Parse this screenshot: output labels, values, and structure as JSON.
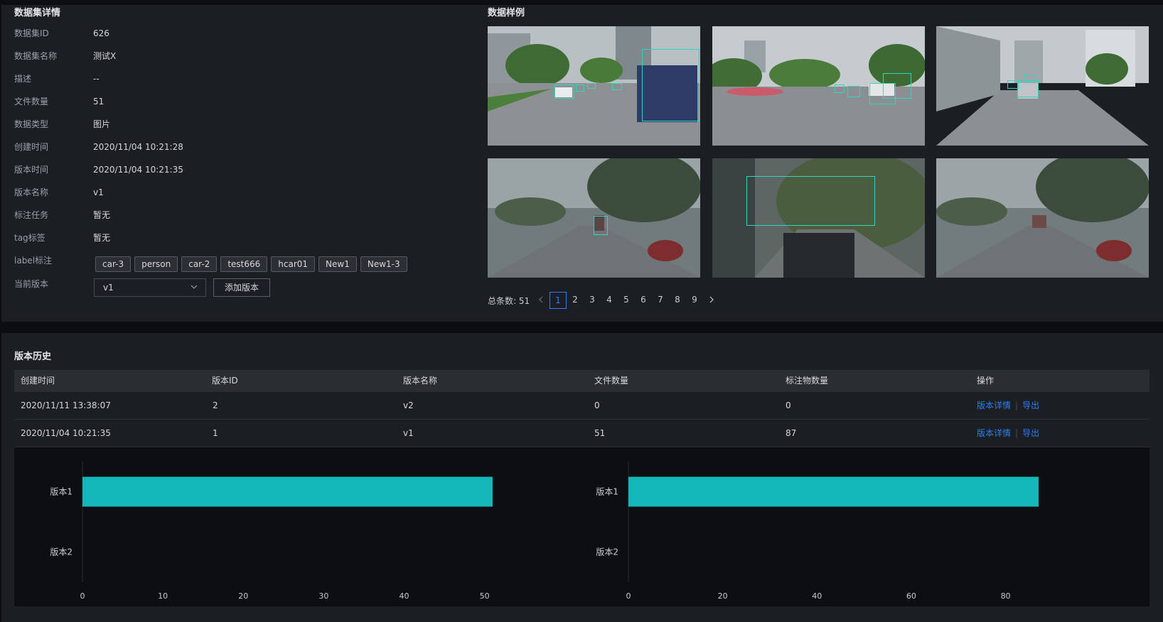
{
  "details": {
    "title": "数据集详情",
    "rows": [
      {
        "key": "数据集ID",
        "value": "626"
      },
      {
        "key": "数据集名称",
        "value": "测试X"
      },
      {
        "key": "描述",
        "value": "--"
      },
      {
        "key": "文件数量",
        "value": "51"
      },
      {
        "key": "数据类型",
        "value": "图片"
      },
      {
        "key": "创建时间",
        "value": "2020/11/04 10:21:28"
      },
      {
        "key": "版本时间",
        "value": "2020/11/04 10:21:35"
      },
      {
        "key": "版本名称",
        "value": "v1"
      },
      {
        "key": "标注任务",
        "value": "暂无"
      },
      {
        "key": "tag标签",
        "value": "暂无"
      }
    ],
    "label_key": "label标注",
    "labels": [
      "car-3",
      "person",
      "car-2",
      "test666",
      "hcar01",
      "New1",
      "New1-3"
    ],
    "version_key": "当前版本",
    "version_select": "v1",
    "add_version_button": "添加版本"
  },
  "samples": {
    "title": "数据样例",
    "total_label": "总条数: 51",
    "pages": [
      "1",
      "2",
      "3",
      "4",
      "5",
      "6",
      "7",
      "8",
      "9"
    ],
    "active_page": "1"
  },
  "history": {
    "title": "版本历史",
    "columns": [
      "创建时间",
      "版本ID",
      "版本名称",
      "文件数量",
      "标注物数量",
      "操作"
    ],
    "rows": [
      {
        "created": "2020/11/11 13:38:07",
        "id": "2",
        "name": "v2",
        "files": "0",
        "annotations": "0",
        "detail": "版本详情",
        "export": "导出"
      },
      {
        "created": "2020/11/04 10:21:35",
        "id": "1",
        "name": "v1",
        "files": "51",
        "annotations": "87",
        "detail": "版本详情",
        "export": "导出"
      }
    ]
  },
  "colors": {
    "accent": "#2d7ef7",
    "bar": "#13b8bb",
    "box": "#2fd6c0"
  },
  "chart_data": [
    {
      "type": "bar",
      "orientation": "horizontal",
      "categories": [
        "版本1",
        "版本2"
      ],
      "values": [
        51,
        0
      ],
      "xlim": [
        0,
        51
      ],
      "xticks": [
        0,
        10,
        20,
        30,
        40,
        50
      ]
    },
    {
      "type": "bar",
      "orientation": "horizontal",
      "categories": [
        "版本1",
        "版本2"
      ],
      "values": [
        87,
        0
      ],
      "xlim": [
        0,
        87
      ],
      "xticks": [
        0,
        20,
        40,
        60,
        80
      ]
    }
  ]
}
